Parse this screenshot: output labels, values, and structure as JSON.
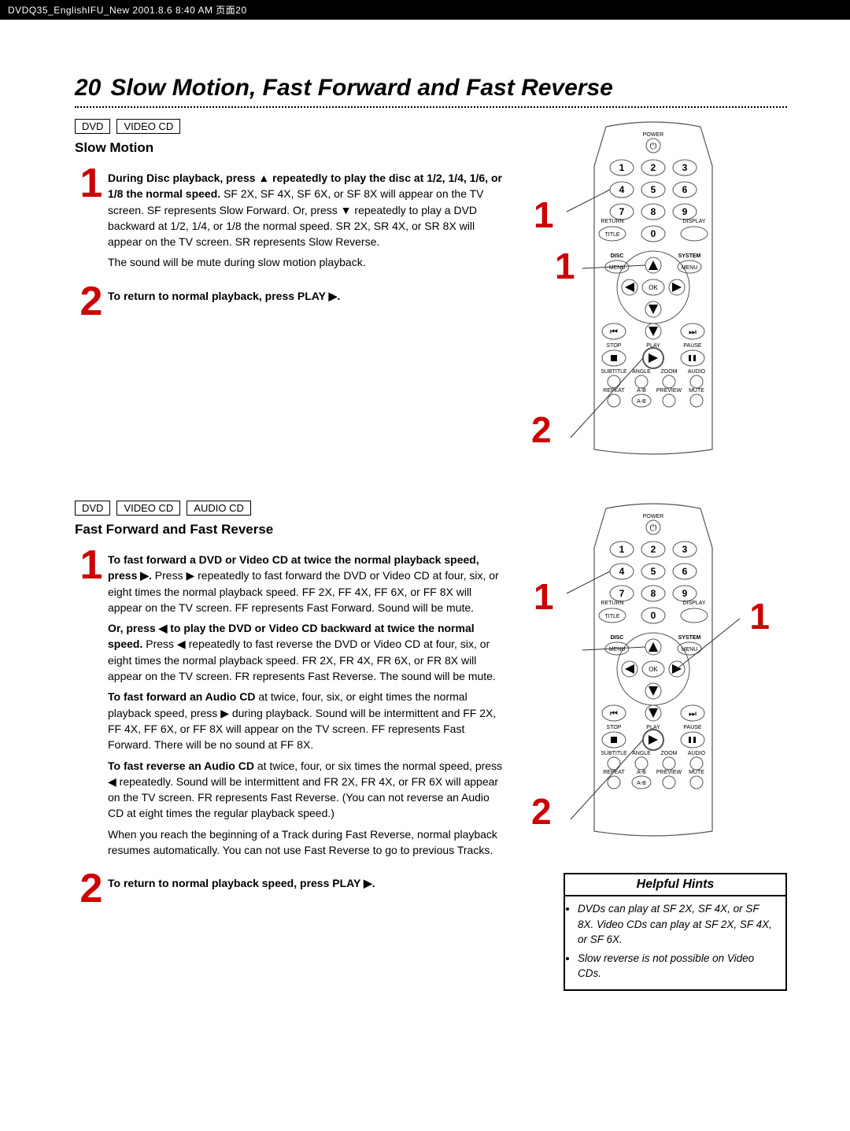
{
  "header_strip": "DVDQ35_EnglishIFU_New  2001.8.6  8:40 AM  页面20",
  "page_number": "20",
  "page_title": "Slow Motion, Fast Forward and Fast Reverse",
  "tags": {
    "dvd": "DVD",
    "video_cd": "VIDEO CD",
    "audio_cd": "AUDIO CD"
  },
  "slow": {
    "subhead": "Slow Motion",
    "step1": {
      "lead": "During Disc playback, press ▲ repeatedly to play the disc at 1/2, 1/4, 1/6, or 1/8 the normal speed.",
      "body": "SF 2X, SF 4X, SF 6X, or SF 8X will appear on the TV screen. SF represents Slow Forward. Or, press ▼ repeatedly to play a DVD backward at 1/2, 1/4, or 1/8 the normal speed. SR 2X, SR 4X, or SR 8X will appear on the TV screen. SR represents Slow Reverse.",
      "tail": "The sound will be mute during slow motion playback."
    },
    "step2": "To return to normal playback, press PLAY ▶."
  },
  "fast": {
    "subhead": "Fast Forward and Fast Reverse",
    "step1": {
      "p1_lead": "To fast forward a DVD or Video CD at twice the normal playback speed, press ▶.",
      "p1_body": " Press ▶ repeatedly to fast forward the DVD or Video CD at four, six, or eight times the normal playback speed. FF 2X, FF 4X, FF 6X, or FF 8X will appear on the TV screen. FF represents Fast Forward. Sound will be mute.",
      "p2_lead": "Or, press ◀ to play the DVD or Video CD backward at twice the normal speed.",
      "p2_body": " Press ◀ repeatedly to fast reverse the DVD or Video CD at four, six, or eight times the normal playback speed. FR 2X, FR 4X, FR 6X, or FR 8X will appear on the TV screen. FR represents Fast Reverse. The sound will be mute.",
      "p3_lead": "To fast forward an Audio CD",
      "p3_body": " at twice, four, six, or eight times the normal playback speed, press ▶ during playback. Sound will be intermittent and FF 2X, FF 4X, FF 6X, or FF 8X will appear on the TV screen. FF represents Fast Forward. There will be no sound at FF 8X.",
      "p4_lead": "To fast reverse an Audio CD",
      "p4_body": " at twice, four, or six times the normal speed, press ◀ repeatedly. Sound will be intermittent and FR 2X, FR 4X, or FR 6X will appear on the TV screen. FR represents Fast Reverse. (You can not reverse an Audio CD at eight times the regular playback speed.)",
      "p5": "When you reach the beginning of a Track during Fast Reverse, normal playback resumes automatically. You can not use Fast Reverse to go to previous Tracks."
    },
    "step2": "To return to normal playback speed, press PLAY ▶."
  },
  "hints": {
    "title": "Helpful Hints",
    "items": [
      "DVDs can play at SF 2X, SF 4X, or SF 8X. Video CDs can play at SF 2X, SF 4X, or SF 6X.",
      "Slow reverse is not possible on Video CDs."
    ]
  },
  "remote": {
    "power": "POWER",
    "nums": [
      "1",
      "2",
      "3",
      "4",
      "5",
      "6",
      "7",
      "8",
      "9",
      "0"
    ],
    "return": "RETURN",
    "title": "TITLE",
    "display": "DISPLAY",
    "disc": "DISC",
    "menu_l": "MENU",
    "system": "SYSTEM",
    "menu_r": "MENU",
    "ok": "OK",
    "stop": "STOP",
    "play": "PLAY",
    "pause": "PAUSE",
    "subtitle": "SUBTITLE",
    "angle": "ANGLE",
    "zoom": "ZOOM",
    "audio": "AUDIO",
    "repeat": "REPEAT",
    "ab": "A-B",
    "preview": "PREVIEW",
    "mute": "MUTE"
  }
}
